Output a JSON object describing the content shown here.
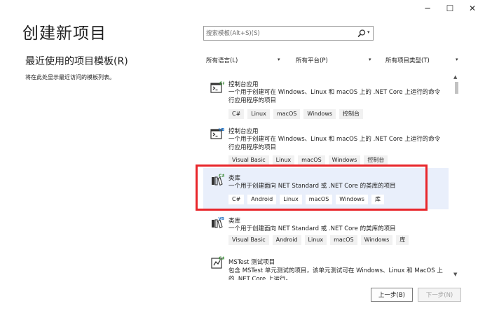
{
  "window": {
    "min_glyph": "─",
    "max_glyph": "☐",
    "close_glyph": "✕"
  },
  "page_title": "创建新项目",
  "recent": {
    "title": "最近使用的项目模板(R)",
    "hint": "将在此处显示最近访问的模板列表。"
  },
  "search": {
    "placeholder": "搜索模板(Alt+S)(S)",
    "icon": "search-icon",
    "dropdown_glyph": "▾"
  },
  "filters": {
    "language": "所有语言(L)",
    "platform": "所有平台(P)",
    "project_type": "所有项目类型(T)",
    "arrow": "▾"
  },
  "templates": [
    {
      "name": "控制台应用",
      "description": "一个用于创建可在 Windows、Linux 和 macOS 上的 .NET Core 上运行的命令行应用程序的项目",
      "tags": [
        "C#",
        "Linux",
        "macOS",
        "Windows",
        "控制台"
      ],
      "icon": "console-csharp-icon",
      "icon_badge": "C#",
      "selected": false
    },
    {
      "name": "控制台应用",
      "description": "一个用于创建可在 Windows、Linux 和 macOS 上的 .NET Core 上运行的命令行应用程序的项目",
      "tags": [
        "Visual Basic",
        "Linux",
        "macOS",
        "Windows",
        "控制台"
      ],
      "icon": "console-vb-icon",
      "icon_badge": "VB",
      "selected": false
    },
    {
      "name": "类库",
      "description": "一个用于创建面向 NET Standard 或 .NET Core 的类库的项目",
      "tags": [
        "C#",
        "Android",
        "Linux",
        "macOS",
        "Windows",
        "库"
      ],
      "icon": "class-library-csharp-icon",
      "icon_badge": "C#",
      "selected": true
    },
    {
      "name": "类库",
      "description": "一个用于创建面向 NET Standard 或 .NET Core 的类库的项目",
      "tags": [
        "Visual Basic",
        "Android",
        "Linux",
        "macOS",
        "Windows",
        "库"
      ],
      "icon": "class-library-vb-icon",
      "icon_badge": "VB",
      "selected": false
    },
    {
      "name": "MSTest 测试项目",
      "description": "包含 MSTest 单元测试的项目，该单元测试可在 Windows、Linux 和 MacOS 上的 .NET Core 上运行。",
      "tags": [],
      "icon": "mstest-icon",
      "icon_badge": "C#",
      "selected": false
    }
  ],
  "scroll": {
    "up_glyph": "▲",
    "down_glyph": "▼"
  },
  "footer": {
    "back_label": "上一步(B)",
    "next_label": "下一步(N)"
  },
  "colors": {
    "highlight_border": "#e8262b",
    "selected_bg": "#e9effb",
    "csharp_badge": "#388a34",
    "vb_badge": "#1b6fc2"
  }
}
